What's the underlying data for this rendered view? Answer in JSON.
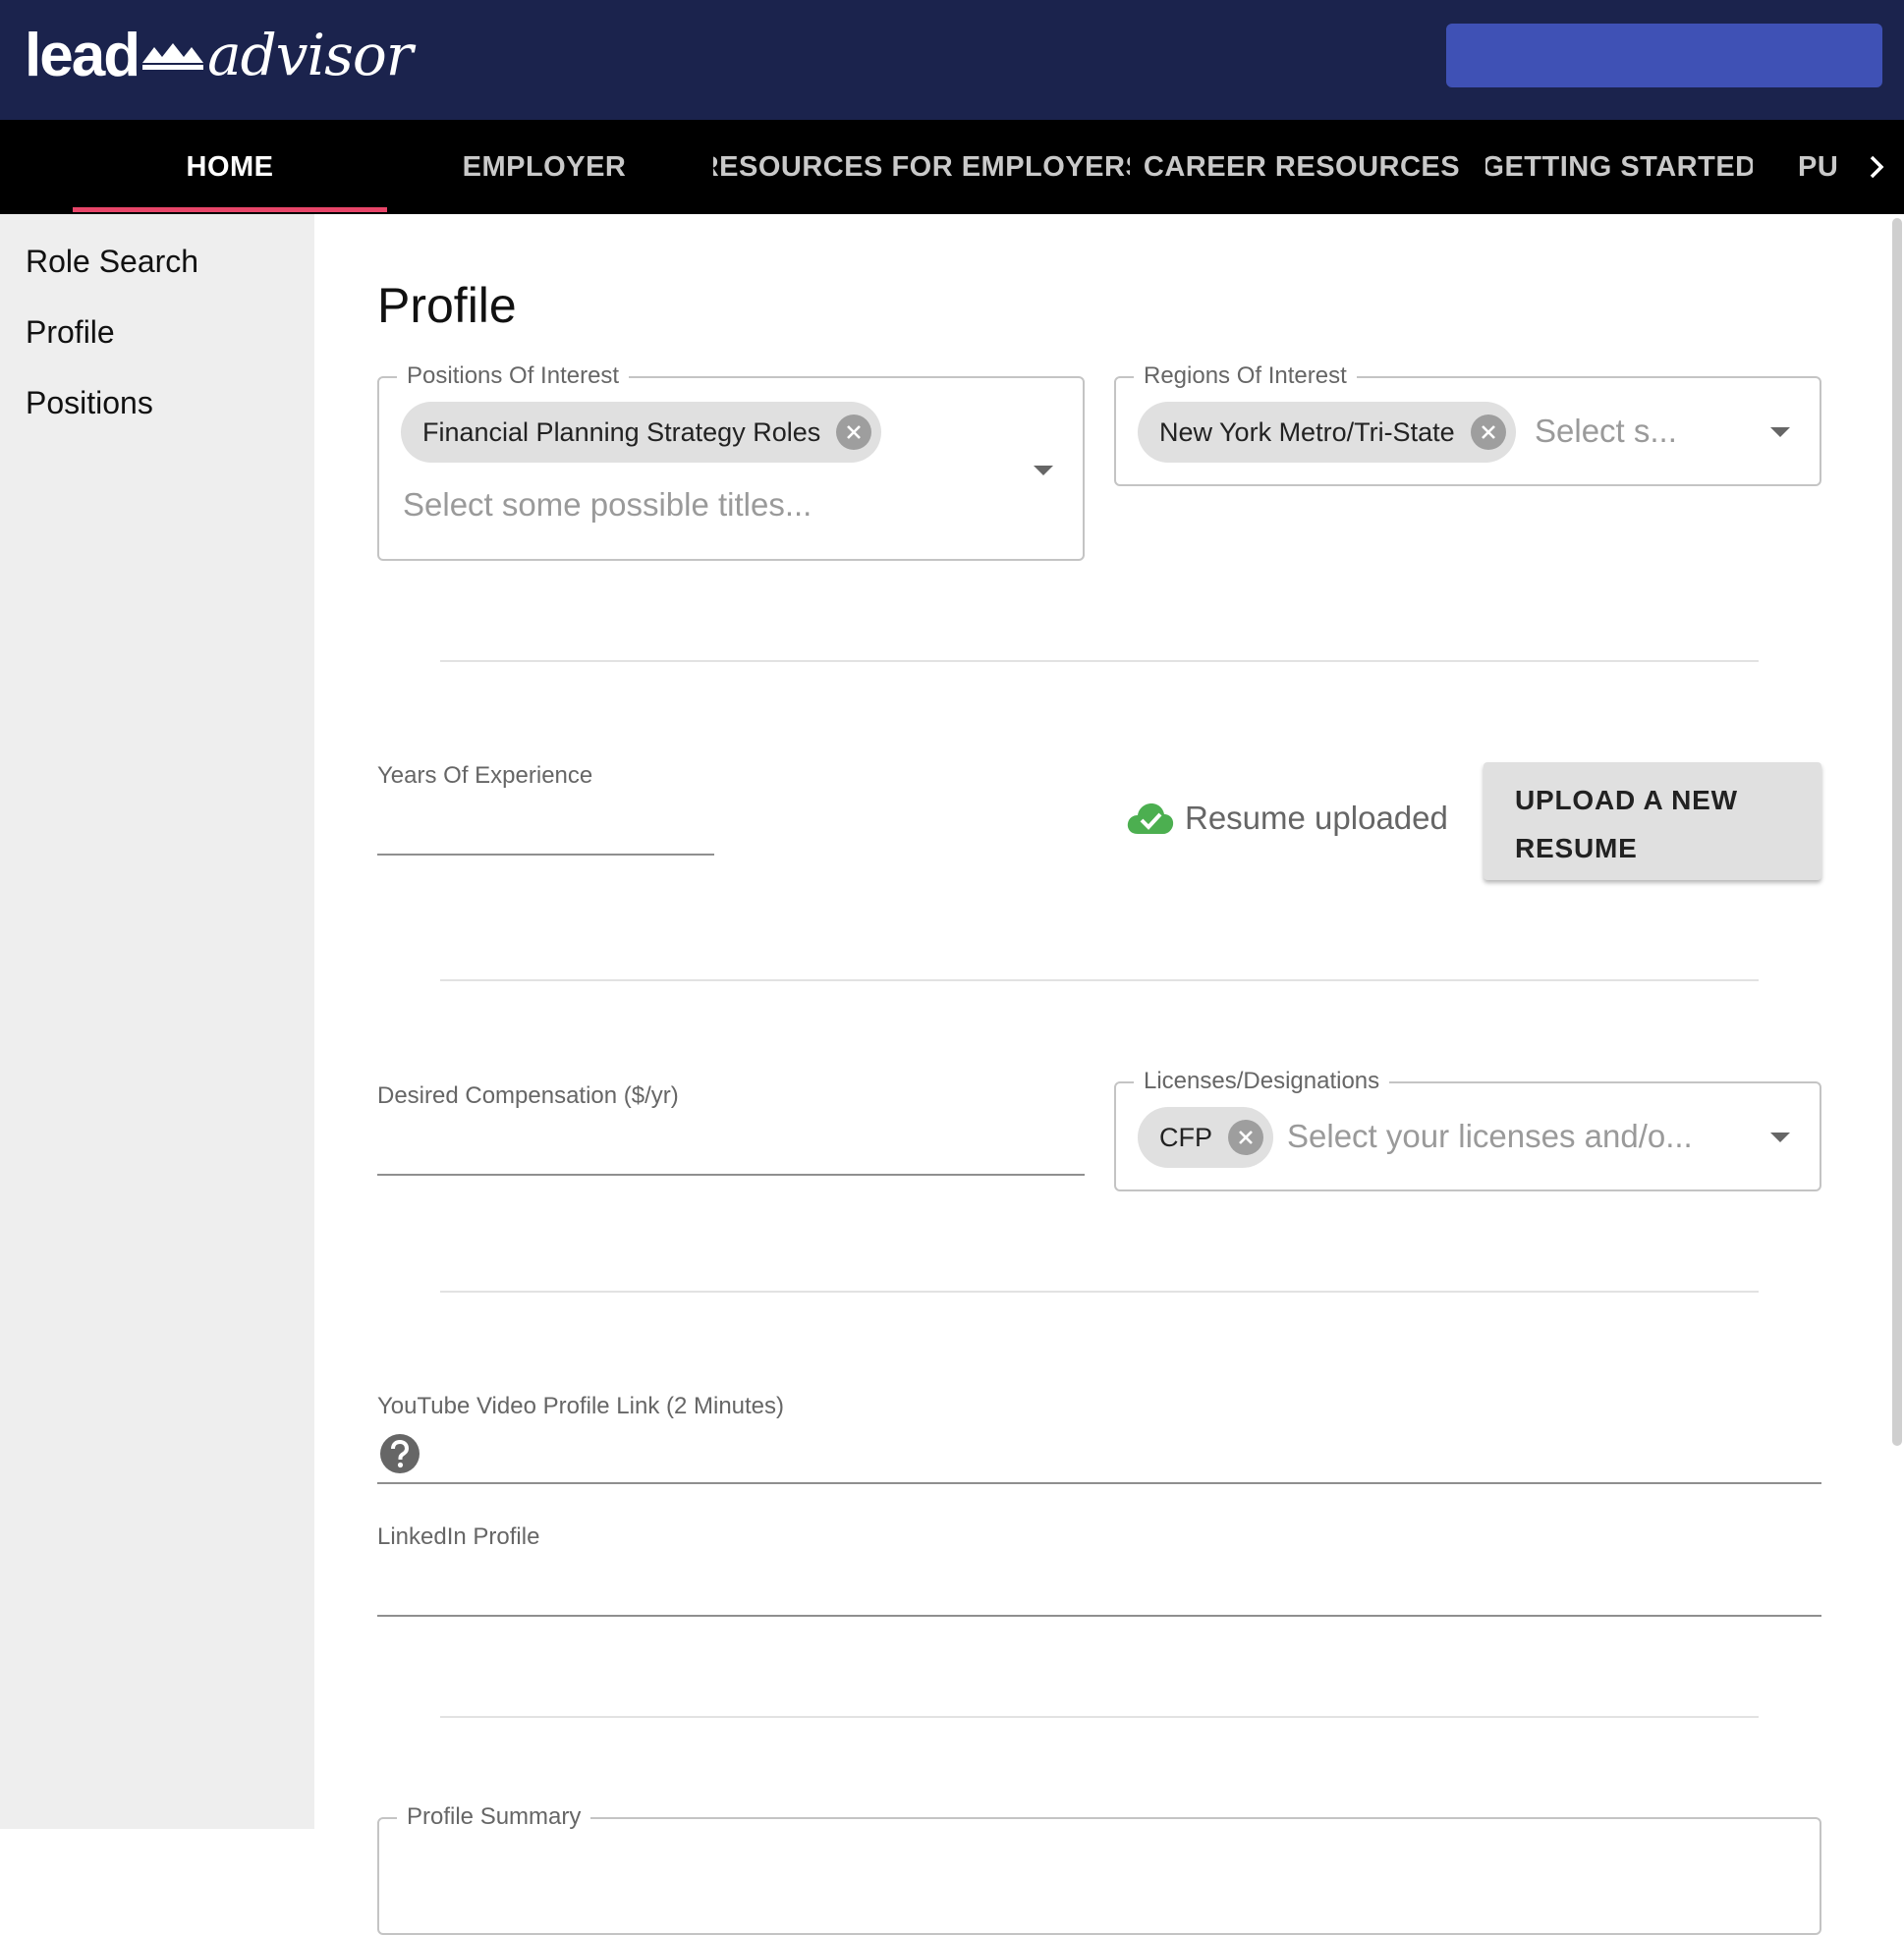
{
  "header": {
    "logo_lead": "lead",
    "logo_advisor": "advisor",
    "action_button_label": ""
  },
  "nav": {
    "tabs": [
      "HOME",
      "EMPLOYER",
      "RESOURCES FOR EMPLOYERS",
      "CAREER RESOURCES",
      "GETTING STARTED",
      "PU"
    ],
    "active": "HOME"
  },
  "sidebar": {
    "items": [
      "Role Search",
      "Profile",
      "Positions"
    ]
  },
  "main": {
    "title": "Profile",
    "positions": {
      "label": "Positions Of Interest",
      "chips": [
        "Financial Planning Strategy Roles"
      ],
      "placeholder": "Select some possible titles..."
    },
    "regions": {
      "label": "Regions Of Interest",
      "chips": [
        "New York Metro/Tri-State"
      ],
      "placeholder": "Select s..."
    },
    "experience": {
      "label": "Years Of Experience",
      "value": ""
    },
    "resume": {
      "status": "Resume uploaded",
      "upload_line1": "UPLOAD A NEW",
      "upload_line2": "RESUME"
    },
    "compensation": {
      "label": "Desired Compensation ($/yr)",
      "value": ""
    },
    "licenses": {
      "label": "Licenses/Designations",
      "chips": [
        "CFP"
      ],
      "placeholder": "Select your licenses and/o..."
    },
    "youtube": {
      "label": "YouTube Video Profile Link (2 Minutes)",
      "value": ""
    },
    "linkedin": {
      "label": "LinkedIn Profile",
      "value": ""
    },
    "summary": {
      "label": "Profile Summary"
    }
  },
  "colors": {
    "header_bg": "#1b234d",
    "accent_button": "#3f51b5",
    "nav_indicator": "#e84569",
    "success": "#4caf50"
  }
}
